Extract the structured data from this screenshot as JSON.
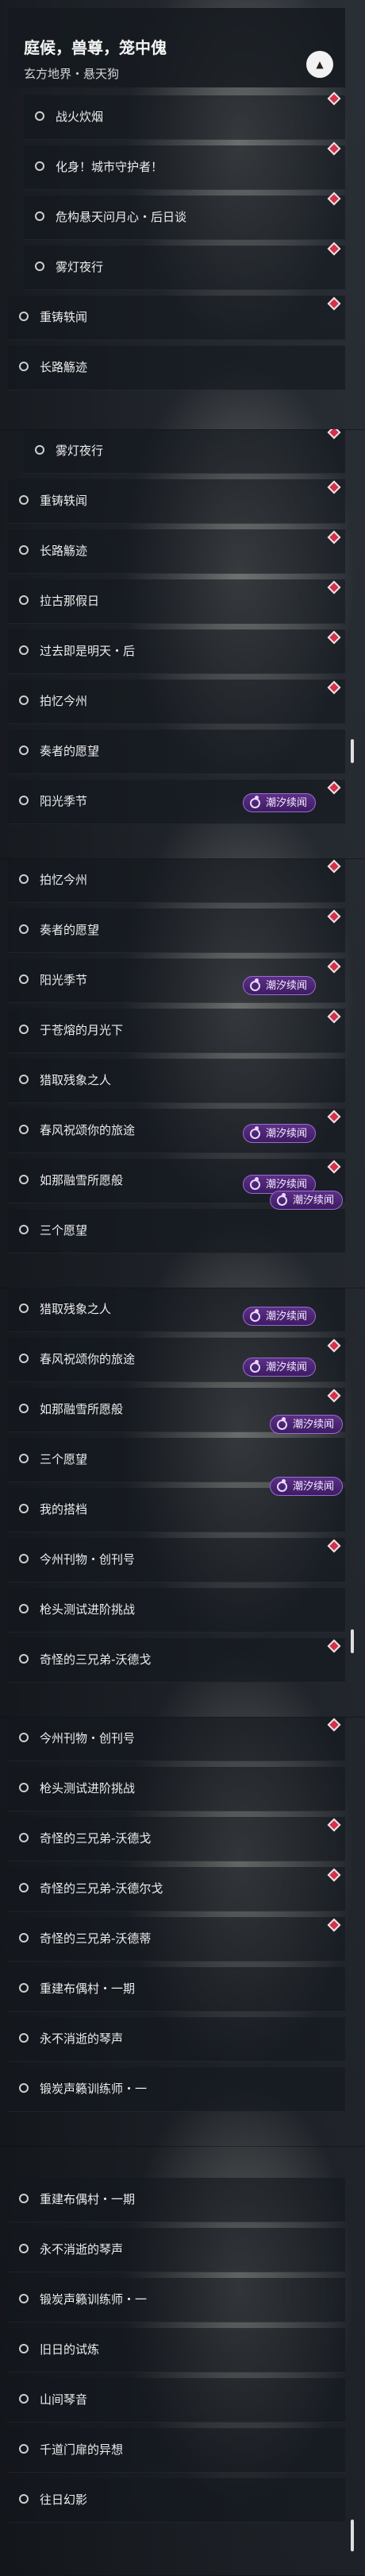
{
  "header": {
    "title": "庭候，兽尊，笼中傀",
    "subtitle": "玄方地界・悬天狗",
    "collapse_icon": "chevron-up-icon"
  },
  "badge_label": "潮汐续闻",
  "panels": [
    {
      "items": [
        "战火炊烟",
        "化身！城市守护者！",
        "危构悬天问月心・后日谈",
        "雾灯夜行",
        "重铸轶闻",
        "长路觞迹"
      ]
    },
    {
      "items": [
        "雾灯夜行",
        "重铸轶闻",
        "长路觞迹",
        "拉古那假日",
        "过去即是明天・后",
        "拍忆今州",
        "奏者的愿望",
        "阳光季节"
      ]
    },
    {
      "items": [
        "拍忆今州",
        "奏者的愿望",
        "阳光季节",
        "于苍熔的月光下",
        "猎取残象之人",
        "春风祝颂你的旅途",
        "如那融雪所愿般",
        "三个愿望"
      ]
    },
    {
      "items": [
        "猎取残象之人",
        "春风祝颂你的旅途",
        "如那融雪所愿般",
        "三个愿望",
        "我的搭档",
        "今州刊物・创刊号",
        "枪头测试进阶挑战",
        "奇怪的三兄弟-沃德戈"
      ]
    },
    {
      "items": [
        "今州刊物・创刊号",
        "枪头测试进阶挑战",
        "奇怪的三兄弟-沃德戈",
        "奇怪的三兄弟-沃德尔戈",
        "奇怪的三兄弟-沃德蒂",
        "重建布偶村・一期",
        "永不消逝的琴声",
        "锻炭声籁训练师・一"
      ]
    },
    {
      "items": [
        "重建布偶村・一期",
        "永不消逝的琴声",
        "锻炭声籁训练师・一",
        "旧日的试炼",
        "山间琴音",
        "千道门扉的异想",
        "往日幻影"
      ]
    }
  ]
}
